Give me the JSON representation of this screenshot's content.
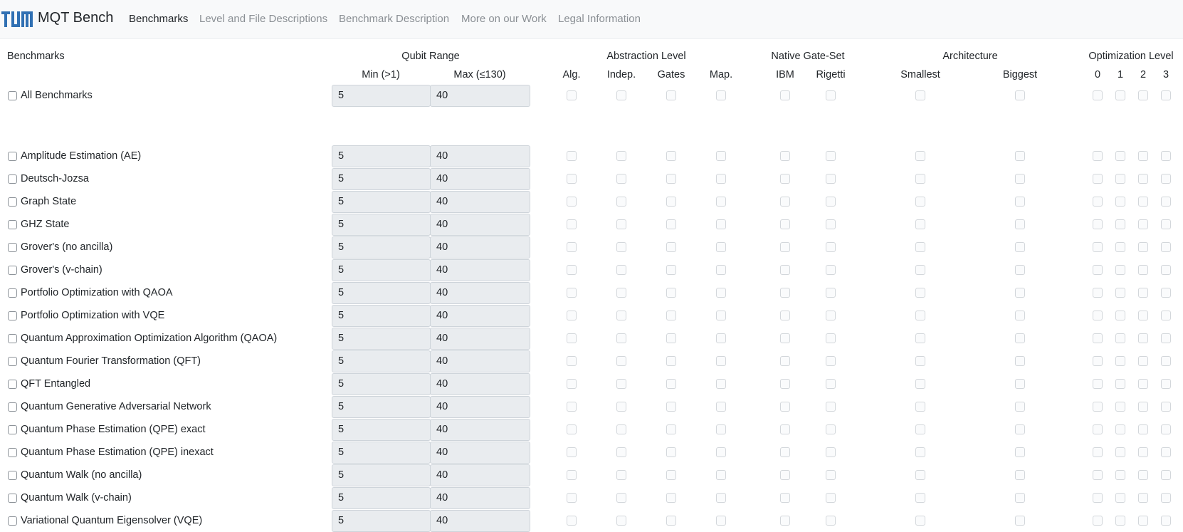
{
  "nav": {
    "logo_icon": "tum-logo-icon",
    "brand": "MQT Bench",
    "links": [
      "Benchmarks",
      "Level and File Descriptions",
      "Benchmark Description",
      "More on our Work",
      "Legal Information"
    ]
  },
  "headers": {
    "benchmarks": "Benchmarks",
    "qubit_range": "Qubit Range",
    "min": "Min (>1)",
    "max": "Max (≤130)",
    "abstraction_level": "Abstraction Level",
    "alg": "Alg.",
    "indep": "Indep.",
    "gates": "Gates",
    "map": "Map.",
    "native_gate_set": "Native Gate-Set",
    "ibm": "IBM",
    "rigetti": "Rigetti",
    "architecture": "Architecture",
    "smallest": "Smallest",
    "biggest": "Biggest",
    "optimization_level": "Optimization Level",
    "opt0": "0",
    "opt1": "1",
    "opt2": "2",
    "opt3": "3"
  },
  "all_row": {
    "label": "All Benchmarks",
    "min": "5",
    "max": "40"
  },
  "benchmarks": [
    {
      "label": "Amplitude Estimation (AE)",
      "min": "5",
      "max": "40"
    },
    {
      "label": "Deutsch-Jozsa",
      "min": "5",
      "max": "40"
    },
    {
      "label": "Graph State",
      "min": "5",
      "max": "40"
    },
    {
      "label": "GHZ State",
      "min": "5",
      "max": "40"
    },
    {
      "label": "Grover's (no ancilla)",
      "min": "5",
      "max": "40"
    },
    {
      "label": "Grover's (v-chain)",
      "min": "5",
      "max": "40"
    },
    {
      "label": "Portfolio Optimization with QAOA",
      "min": "5",
      "max": "40"
    },
    {
      "label": "Portfolio Optimization with VQE",
      "min": "5",
      "max": "40"
    },
    {
      "label": "Quantum Approximation Optimization Algorithm (QAOA)",
      "min": "5",
      "max": "40"
    },
    {
      "label": "Quantum Fourier Transformation (QFT)",
      "min": "5",
      "max": "40"
    },
    {
      "label": "QFT Entangled",
      "min": "5",
      "max": "40"
    },
    {
      "label": "Quantum Generative Adversarial Network",
      "min": "5",
      "max": "40"
    },
    {
      "label": "Quantum Phase Estimation (QPE) exact",
      "min": "5",
      "max": "40"
    },
    {
      "label": "Quantum Phase Estimation (QPE) inexact",
      "min": "5",
      "max": "40"
    },
    {
      "label": "Quantum Walk (no ancilla)",
      "min": "5",
      "max": "40"
    },
    {
      "label": "Quantum Walk (v-chain)",
      "min": "5",
      "max": "40"
    },
    {
      "label": "Variational Quantum Eigensolver (VQE)",
      "min": "5",
      "max": "40"
    }
  ],
  "colors": {
    "navbar_bg": "#f8f9fa",
    "logo_blue": "#3070b3",
    "input_bg": "#e9ecef"
  }
}
